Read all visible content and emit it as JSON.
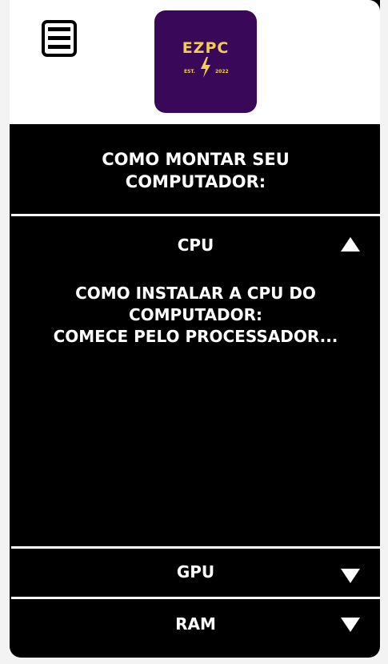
{
  "header": {
    "logo": {
      "name": "EZPC",
      "est": "EST.",
      "year": "2022",
      "colors": {
        "background": "#3a0858",
        "text": "#f2cd54"
      }
    },
    "menu_icon": "hamburger-menu-icon"
  },
  "main": {
    "title": "COMO MONTAR SEU\nCOMPUTADOR:",
    "accordion": [
      {
        "label": "CPU",
        "expanded": true,
        "arrow_icon": "triangle-up-icon",
        "content": "COMO INSTALAR A CPU DO\nCOMPUTADOR:\nCOMECE PELO PROCESSADOR..."
      },
      {
        "label": "GPU",
        "expanded": false,
        "arrow_icon": "triangle-down-icon"
      },
      {
        "label": "RAM",
        "expanded": false,
        "arrow_icon": "triangle-down-icon"
      }
    ]
  },
  "colors": {
    "page_background": "#f3f3f3",
    "card_background": "#000000",
    "text": "#ffffff"
  }
}
